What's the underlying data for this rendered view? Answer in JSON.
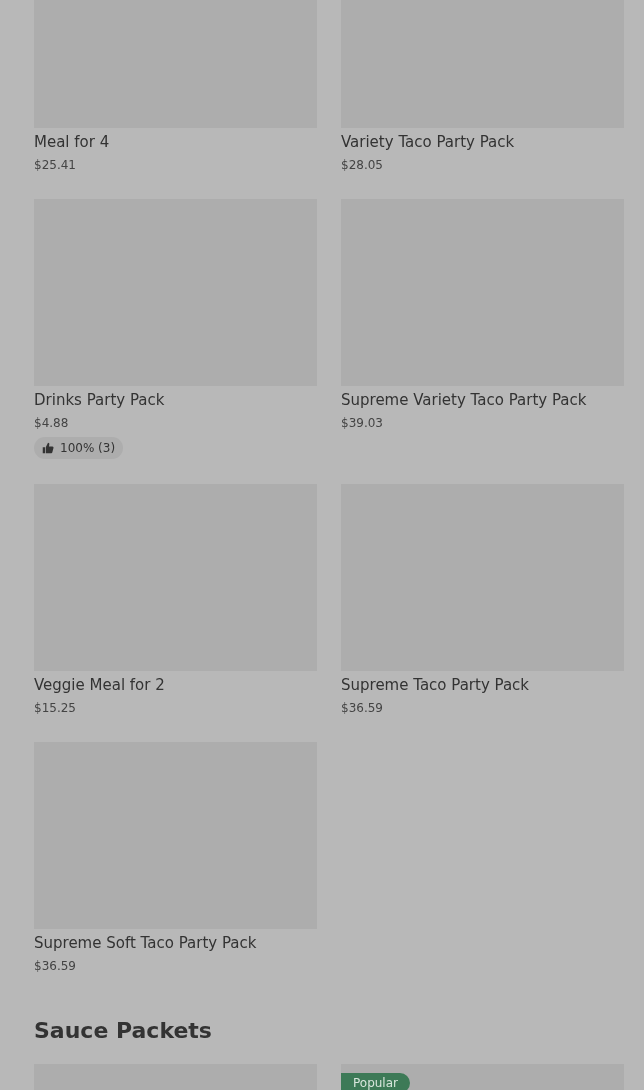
{
  "sections": [
    {
      "items": [
        {
          "kind": "product",
          "name": "Meal for 4",
          "price": "$25.41"
        },
        {
          "kind": "product",
          "name": "Variety Taco Party Pack",
          "price": "$28.05"
        },
        {
          "kind": "product",
          "name": "Drinks Party Pack",
          "price": "$4.88",
          "rating": "100% (3)"
        },
        {
          "kind": "product",
          "name": "Supreme Variety Taco Party Pack",
          "price": "$39.03"
        },
        {
          "kind": "product",
          "name": "Veggie Meal for 2",
          "price": "$15.25"
        },
        {
          "kind": "product",
          "name": "Supreme Taco Party Pack",
          "price": "$36.59"
        },
        {
          "kind": "product",
          "name": "Supreme Soft Taco Party Pack",
          "price": "$36.59"
        }
      ]
    },
    {
      "heading": "Sauce Packets",
      "items": [
        {
          "kind": "product"
        },
        {
          "kind": "product",
          "tag": "Popular"
        }
      ]
    }
  ]
}
